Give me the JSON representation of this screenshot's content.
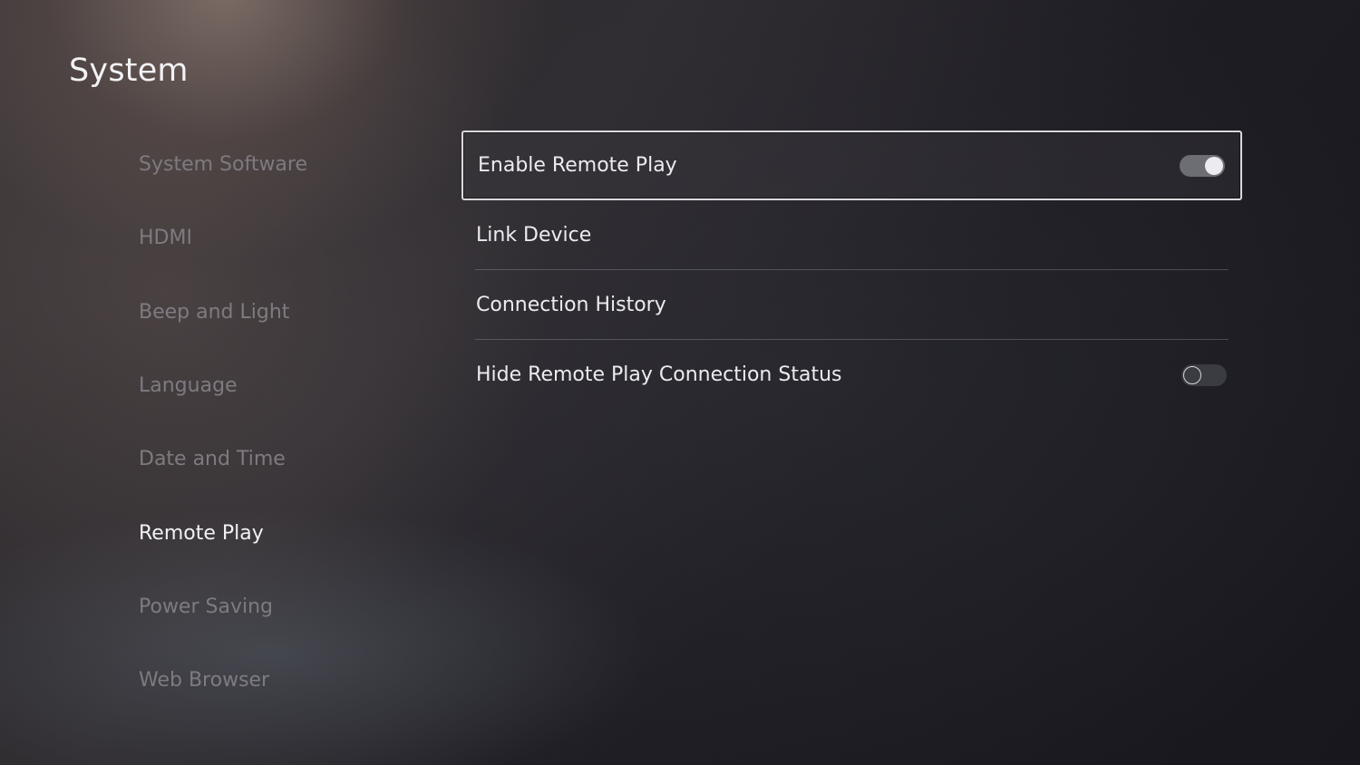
{
  "header": {
    "title": "System"
  },
  "sidebar": {
    "items": [
      {
        "label": "System Software",
        "active": false
      },
      {
        "label": "HDMI",
        "active": false
      },
      {
        "label": "Beep and Light",
        "active": false
      },
      {
        "label": "Language",
        "active": false
      },
      {
        "label": "Date and Time",
        "active": false
      },
      {
        "label": "Remote Play",
        "active": true
      },
      {
        "label": "Power Saving",
        "active": false
      },
      {
        "label": "Web Browser",
        "active": false
      }
    ]
  },
  "main": {
    "rows": [
      {
        "label": "Enable Remote Play",
        "control": "toggle",
        "toggle_state": "on",
        "focused": true
      },
      {
        "label": "Link Device",
        "control": "none"
      },
      {
        "label": "Connection History",
        "control": "none"
      },
      {
        "label": "Hide Remote Play Connection Status",
        "control": "toggle",
        "toggle_state": "off"
      }
    ]
  },
  "colors": {
    "text_primary": "#ecebef",
    "text_inactive": "#7e7b80",
    "toggle_on_track": "#6d6d74",
    "toggle_off_track": "#3b3b42",
    "focus_border": "#d9d8dd"
  }
}
